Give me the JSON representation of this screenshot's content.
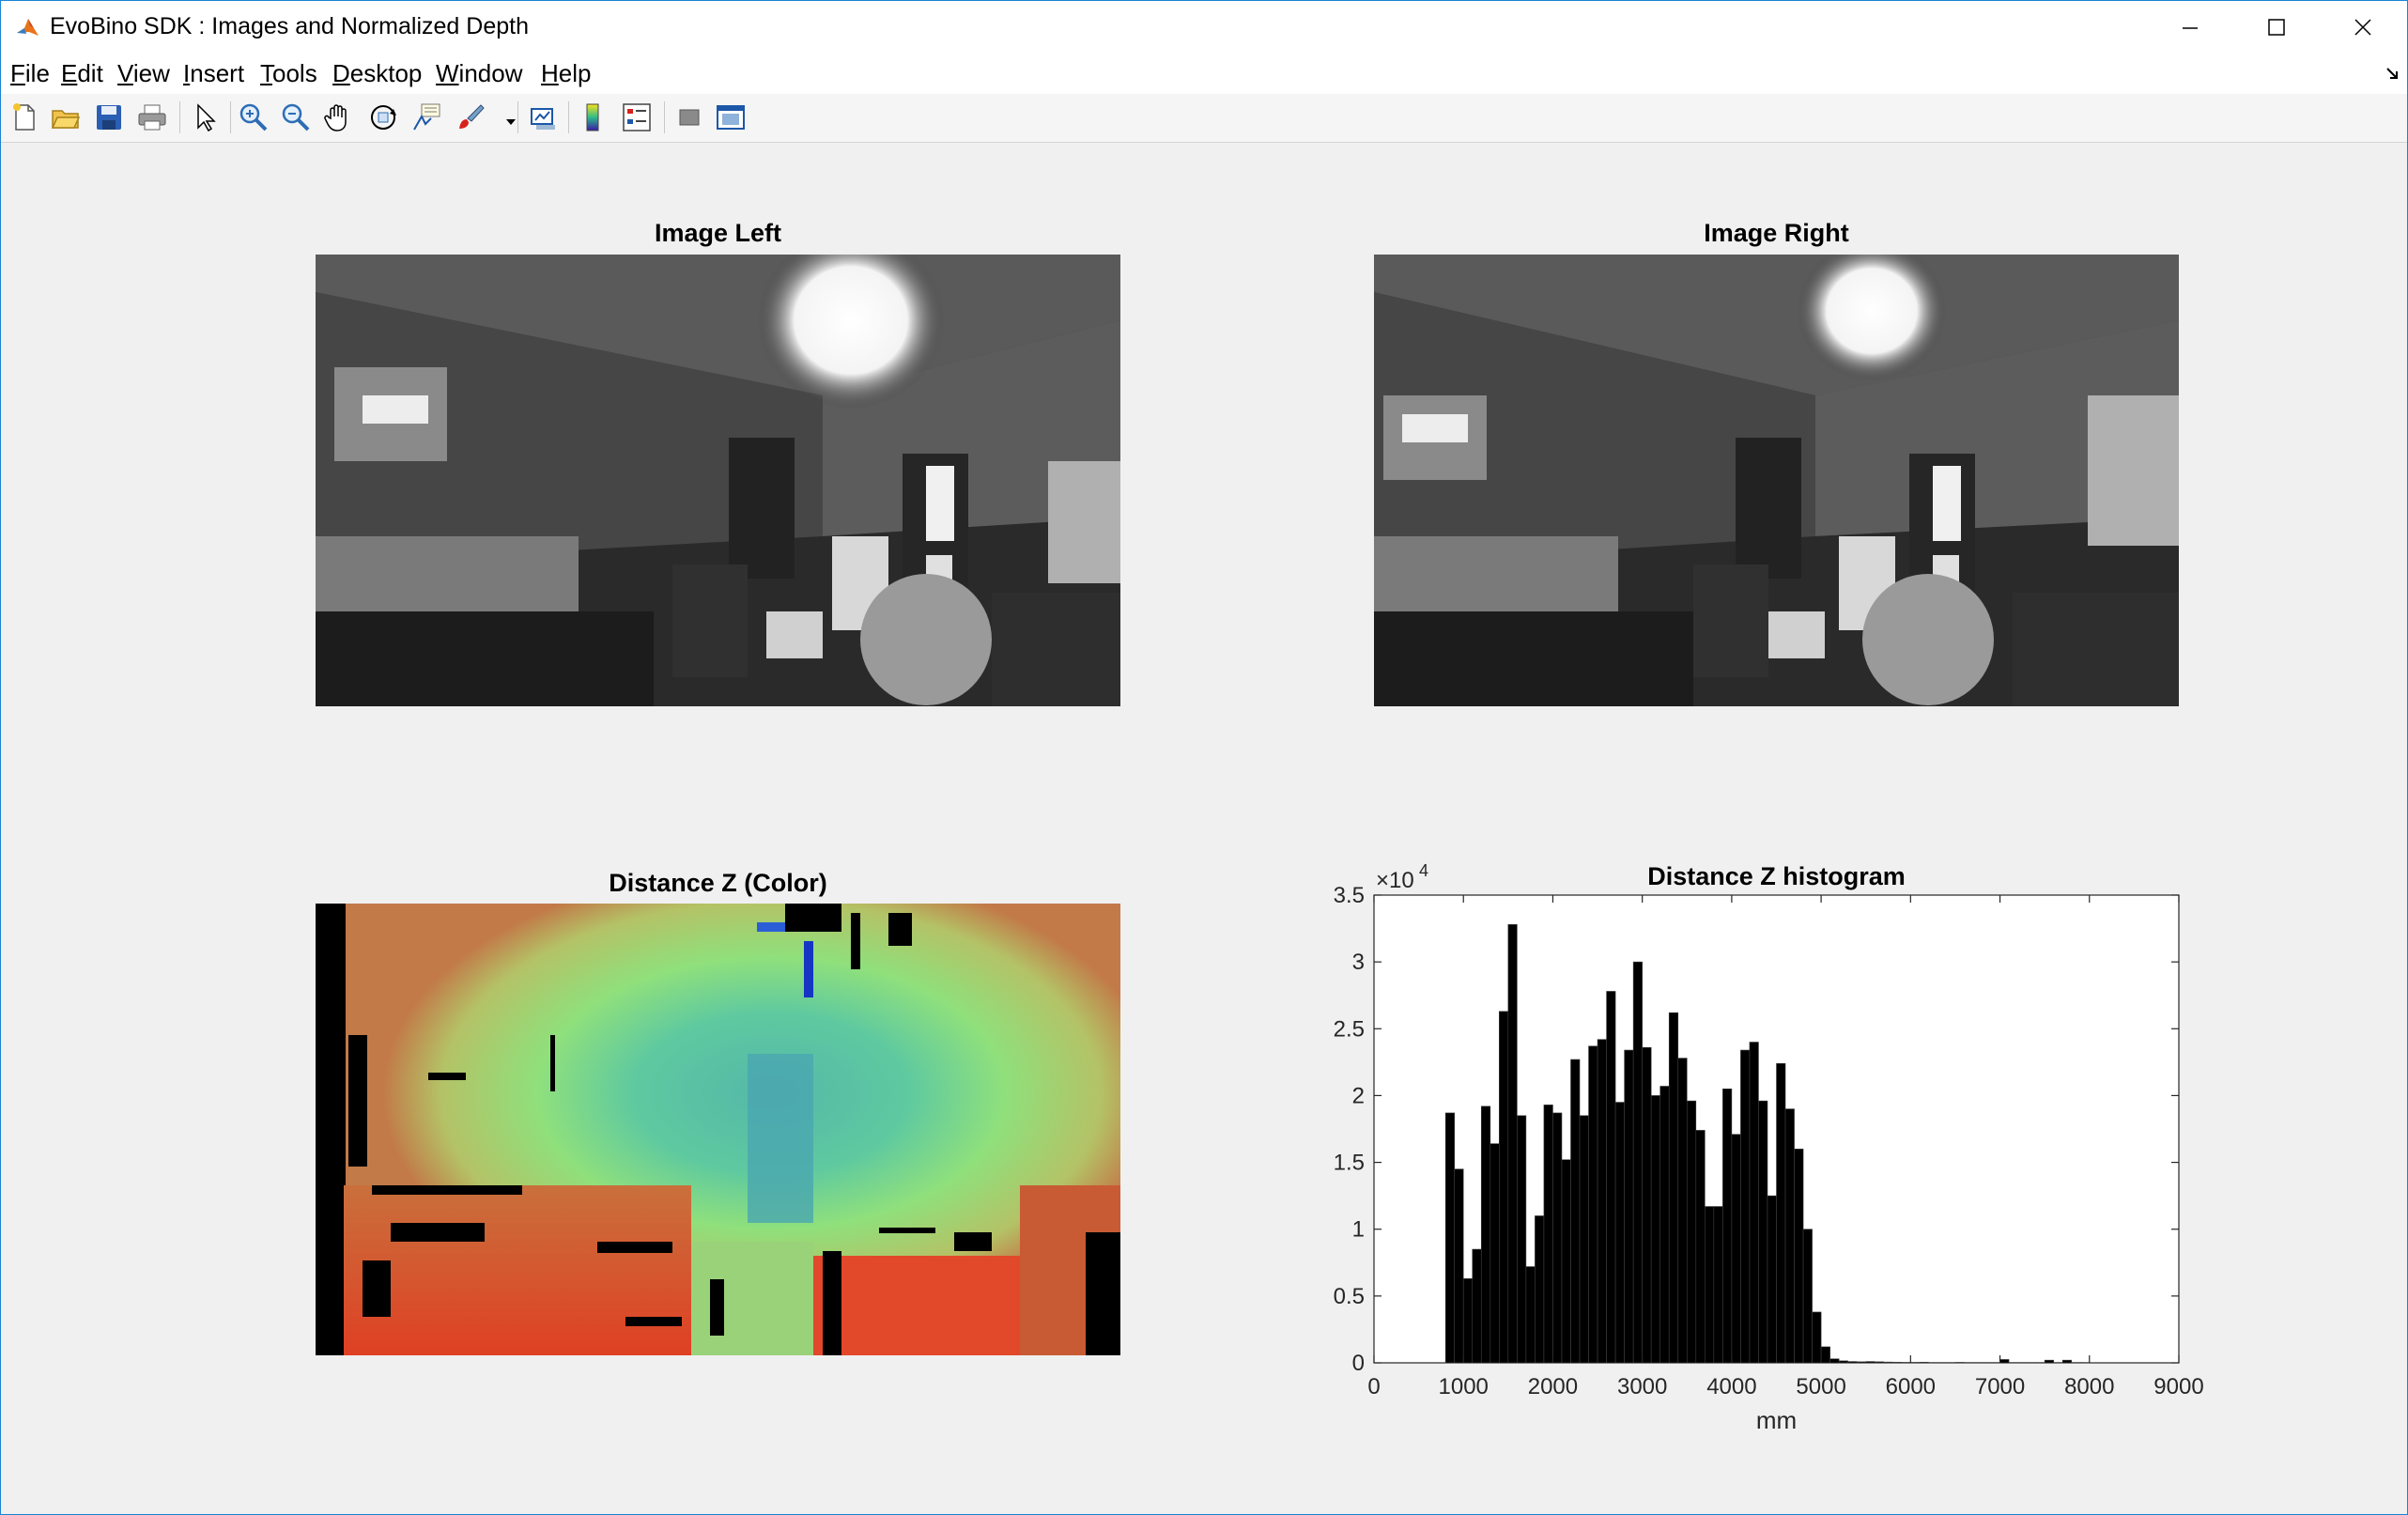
{
  "window": {
    "title": "EvoBino SDK : Images and Normalized Depth",
    "controls": [
      "minimize",
      "maximize",
      "close"
    ]
  },
  "menubar": {
    "items": [
      {
        "label": "File",
        "mnemonic": "F",
        "rest": "ile"
      },
      {
        "label": "Edit",
        "mnemonic": "E",
        "rest": "dit"
      },
      {
        "label": "View",
        "mnemonic": "V",
        "rest": "iew"
      },
      {
        "label": "Insert",
        "mnemonic": "I",
        "rest": "nsert"
      },
      {
        "label": "Tools",
        "mnemonic": "T",
        "rest": "ools"
      },
      {
        "label": "Desktop",
        "mnemonic": "D",
        "rest": "esktop"
      },
      {
        "label": "Window",
        "mnemonic": "W",
        "rest": "indow"
      },
      {
        "label": "Help",
        "mnemonic": "H",
        "rest": "elp"
      }
    ]
  },
  "toolbar": {
    "icons": [
      "new-figure-icon",
      "open-file-icon",
      "save-icon",
      "print-icon",
      "edit-plot-arrow-icon",
      "zoom-in-icon",
      "zoom-out-icon",
      "pan-hand-icon",
      "rotate-3d-icon",
      "data-cursor-icon",
      "brush-icon",
      "brush-dropdown-icon",
      "link-plot-icon",
      "colorbar-icon",
      "legend-icon",
      "hide-plot-tools-icon",
      "show-plot-tools-icon"
    ]
  },
  "figures": {
    "image_left": {
      "title": "Image Left"
    },
    "image_right": {
      "title": "Image Right"
    },
    "depth_color": {
      "title": "Distance Z (Color)"
    },
    "histogram": {
      "title": "Distance Z histogram"
    }
  },
  "chart_data": {
    "type": "bar",
    "title": "Distance Z histogram",
    "xlabel": "mm",
    "ylabel": "",
    "xlim": [
      0,
      9000
    ],
    "ylim": [
      0,
      35000
    ],
    "y_exponent_label": "×10",
    "y_exponent_power": "4",
    "xticks": [
      "0",
      "1000",
      "2000",
      "3000",
      "4000",
      "5000",
      "6000",
      "7000",
      "8000",
      "9000"
    ],
    "yticks": [
      "0",
      "0.5",
      "1",
      "1.5",
      "2",
      "2.5",
      "3",
      "3.5"
    ],
    "bar_color": "#000000",
    "bar_edge_color": "#404040",
    "bin_width": 100,
    "bin_centers": [
      850,
      950,
      1050,
      1150,
      1250,
      1350,
      1450,
      1550,
      1650,
      1750,
      1850,
      1950,
      2050,
      2150,
      2250,
      2350,
      2450,
      2550,
      2650,
      2750,
      2850,
      2950,
      3050,
      3150,
      3250,
      3350,
      3450,
      3550,
      3650,
      3750,
      3850,
      3950,
      4050,
      4150,
      4250,
      4350,
      4450,
      4550,
      4650,
      4750,
      4850,
      4950,
      5050,
      5150,
      5250,
      5350,
      5450,
      5550,
      5650,
      5750,
      5850,
      5950,
      6050,
      6150,
      6250,
      6350,
      6450,
      6550,
      6650,
      6750,
      6850,
      6950,
      7050,
      7150,
      7250,
      7350,
      7450,
      7550,
      7650,
      7750,
      7850,
      7950
    ],
    "values": [
      18700,
      14500,
      6300,
      8500,
      19200,
      16400,
      26300,
      32800,
      18500,
      7200,
      11000,
      19300,
      18700,
      15200,
      22700,
      18500,
      23700,
      24200,
      27800,
      19500,
      23400,
      30000,
      23600,
      20000,
      20700,
      26200,
      22800,
      19600,
      17400,
      11700,
      11700,
      20500,
      17100,
      23400,
      24000,
      19600,
      12500,
      22400,
      19000,
      16000,
      10000,
      3800,
      1200,
      300,
      150,
      100,
      80,
      100,
      80,
      60,
      50,
      40,
      40,
      50,
      30,
      30,
      30,
      40,
      30,
      30,
      30,
      30,
      250,
      30,
      30,
      30,
      30,
      200,
      30,
      200,
      30,
      30
    ]
  }
}
